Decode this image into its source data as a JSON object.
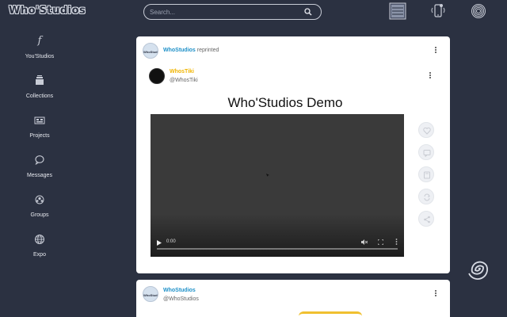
{
  "header": {
    "logo": "Who'Studios",
    "search_placeholder": "Search..."
  },
  "sidebar": {
    "items": [
      {
        "label": "You'Studios",
        "icon": "script-f-icon"
      },
      {
        "label": "Collections",
        "icon": "collection-icon"
      },
      {
        "label": "Projects",
        "icon": "projects-icon"
      },
      {
        "label": "Messages",
        "icon": "message-bubble-icon"
      },
      {
        "label": "Groups",
        "icon": "groups-icon"
      },
      {
        "label": "Expo",
        "icon": "globe-icon"
      }
    ]
  },
  "posts": [
    {
      "author": "WhoStudios",
      "action": "reprinted",
      "reprinted": {
        "author": "WhosTiki",
        "handle": "@WhosTiki",
        "title": "Who'Studios Demo",
        "video_time": "0:00"
      }
    },
    {
      "author": "WhoStudios",
      "handle": "@WhoStudios"
    }
  ],
  "colors": {
    "background": "#2b3141",
    "name_accent": "#1e90c8",
    "reprint_accent": "#f0b400"
  }
}
